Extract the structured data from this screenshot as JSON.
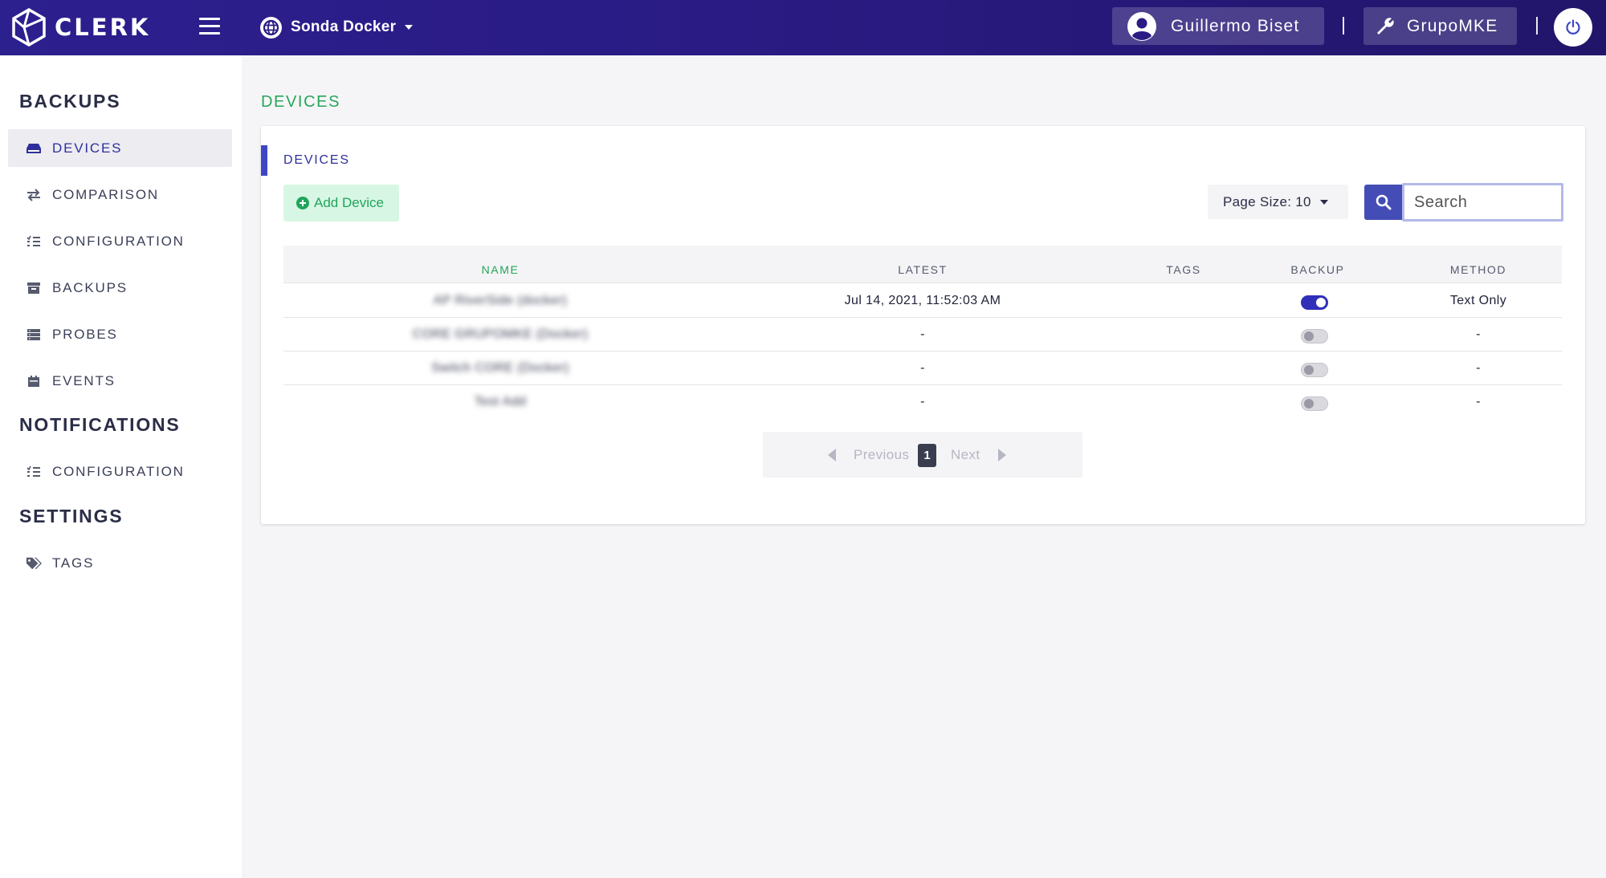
{
  "header": {
    "logo_text": "CLERK",
    "site_name": "Sonda Docker",
    "user_name": "Guillermo Biset",
    "org_name": "GrupoMKE"
  },
  "sidebar": {
    "sections": [
      {
        "title": "BACKUPS",
        "items": [
          {
            "label": "DEVICES",
            "icon": "hdd-icon",
            "active": true
          },
          {
            "label": "COMPARISON",
            "icon": "exchange-icon"
          },
          {
            "label": "CONFIGURATION",
            "icon": "checklist-icon"
          },
          {
            "label": "BACKUPS",
            "icon": "archive-icon"
          },
          {
            "label": "PROBES",
            "icon": "server-icon"
          },
          {
            "label": "EVENTS",
            "icon": "calendar-icon"
          }
        ]
      },
      {
        "title": "NOTIFICATIONS",
        "items": [
          {
            "label": "CONFIGURATION",
            "icon": "checklist-icon"
          }
        ]
      },
      {
        "title": "SETTINGS",
        "items": [
          {
            "label": "TAGS",
            "icon": "tags-icon"
          }
        ]
      }
    ]
  },
  "main": {
    "page_title": "DEVICES",
    "card_title": "DEVICES",
    "add_button": "Add Device",
    "page_size_label": "Page Size: 10",
    "search_placeholder": "Search",
    "columns": [
      "NAME",
      "LATEST",
      "TAGS",
      "BACKUP",
      "METHOD"
    ],
    "rows": [
      {
        "name": "AP RiverSide (docker)",
        "latest": "Jul 14, 2021, 11:52:03 AM",
        "tags": "",
        "backup": true,
        "method": "Text Only"
      },
      {
        "name": "CORE GRUPOMKE (Docker)",
        "latest": "-",
        "tags": "",
        "backup": false,
        "method": "-"
      },
      {
        "name": "Switch CORE (Docker)",
        "latest": "-",
        "tags": "",
        "backup": false,
        "method": "-"
      },
      {
        "name": "Test Add",
        "latest": "-",
        "tags": "",
        "backup": false,
        "method": "-"
      }
    ],
    "pagination": {
      "previous": "Previous",
      "current_page": "1",
      "next": "Next"
    }
  },
  "colors": {
    "header_bg": "#2a1b84",
    "accent_green": "#21a45a",
    "accent_blue": "#2f2f9c",
    "search_button": "#434db5"
  }
}
